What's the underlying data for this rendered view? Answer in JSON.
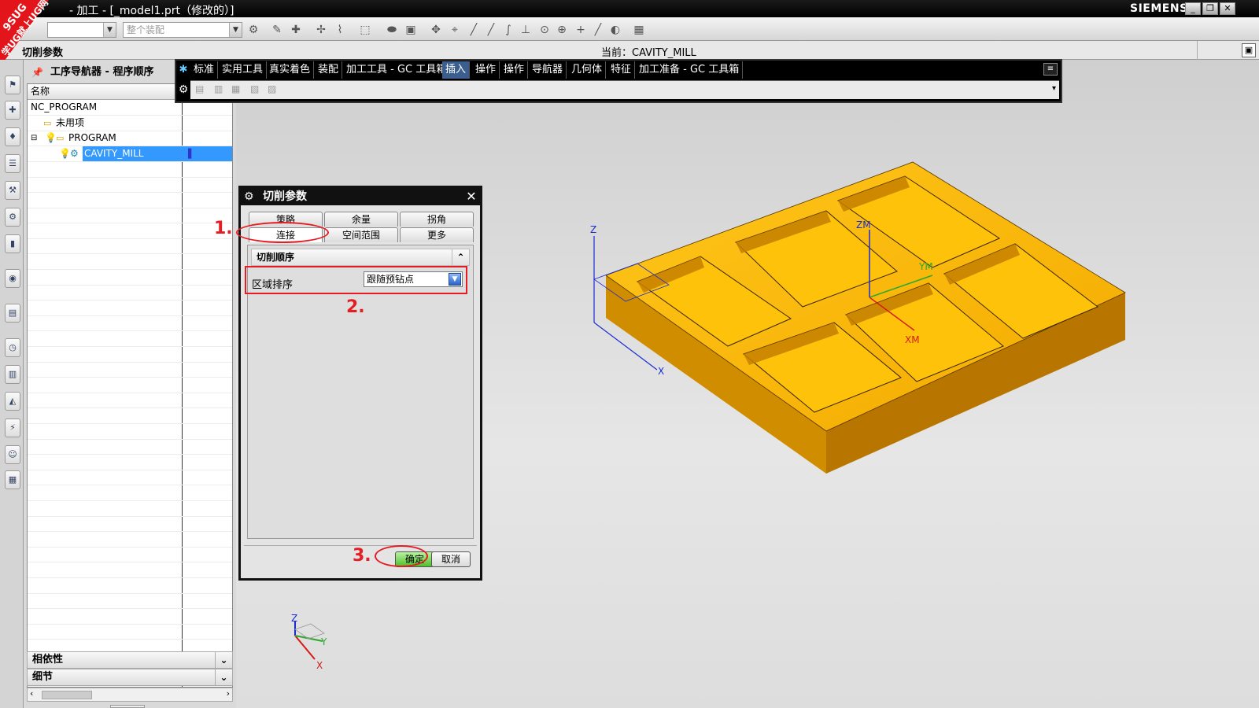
{
  "titlebar": {
    "title": "- 加工 - [_model1.prt（修改的）]",
    "brand": "SIEMENS",
    "corner_badge_line1": "9SUG",
    "corner_badge_line2": "学UG就上UG网"
  },
  "toolbar": {
    "combo1": "",
    "combo2": "整个装配"
  },
  "status_row": {
    "label": "切削参数",
    "current": "当前：CAVITY_MILL"
  },
  "navigator": {
    "title": "工序导航器 - 程序顺序",
    "column_name": "名称",
    "rows": [
      "NC_PROGRAM",
      "未用项",
      "PROGRAM",
      "CAVITY_MILL"
    ],
    "dependencies": "相依性",
    "details": "细节"
  },
  "floating_toolbar": {
    "tabs": [
      "标准",
      "实用工具",
      "真实着色",
      "装配",
      "加工工具 - GC 工具箱",
      "插入",
      "操作",
      "操作",
      "导航器",
      "几何体",
      "特征",
      "加工准备 - GC 工具箱"
    ],
    "active_tab": "插入"
  },
  "dialog": {
    "title": "切削参数",
    "tabs_row1": [
      "策略",
      "余量",
      "拐角"
    ],
    "tabs_row2": [
      "连接",
      "空间范围",
      "更多"
    ],
    "active_tab": "连接",
    "group": "切削顺序",
    "field_label": "区域排序",
    "field_value": "跟随预钻点",
    "ok": "确定",
    "cancel": "取消"
  },
  "annotations": {
    "step1": "1.",
    "step2": "2.",
    "step3": "3."
  },
  "viewport": {
    "axis_labels": {
      "zm": "ZM",
      "ym": "YM",
      "xm": "XM",
      "z": "Z",
      "x": "X",
      "y": "Y"
    },
    "part_color": "#f7b500"
  }
}
